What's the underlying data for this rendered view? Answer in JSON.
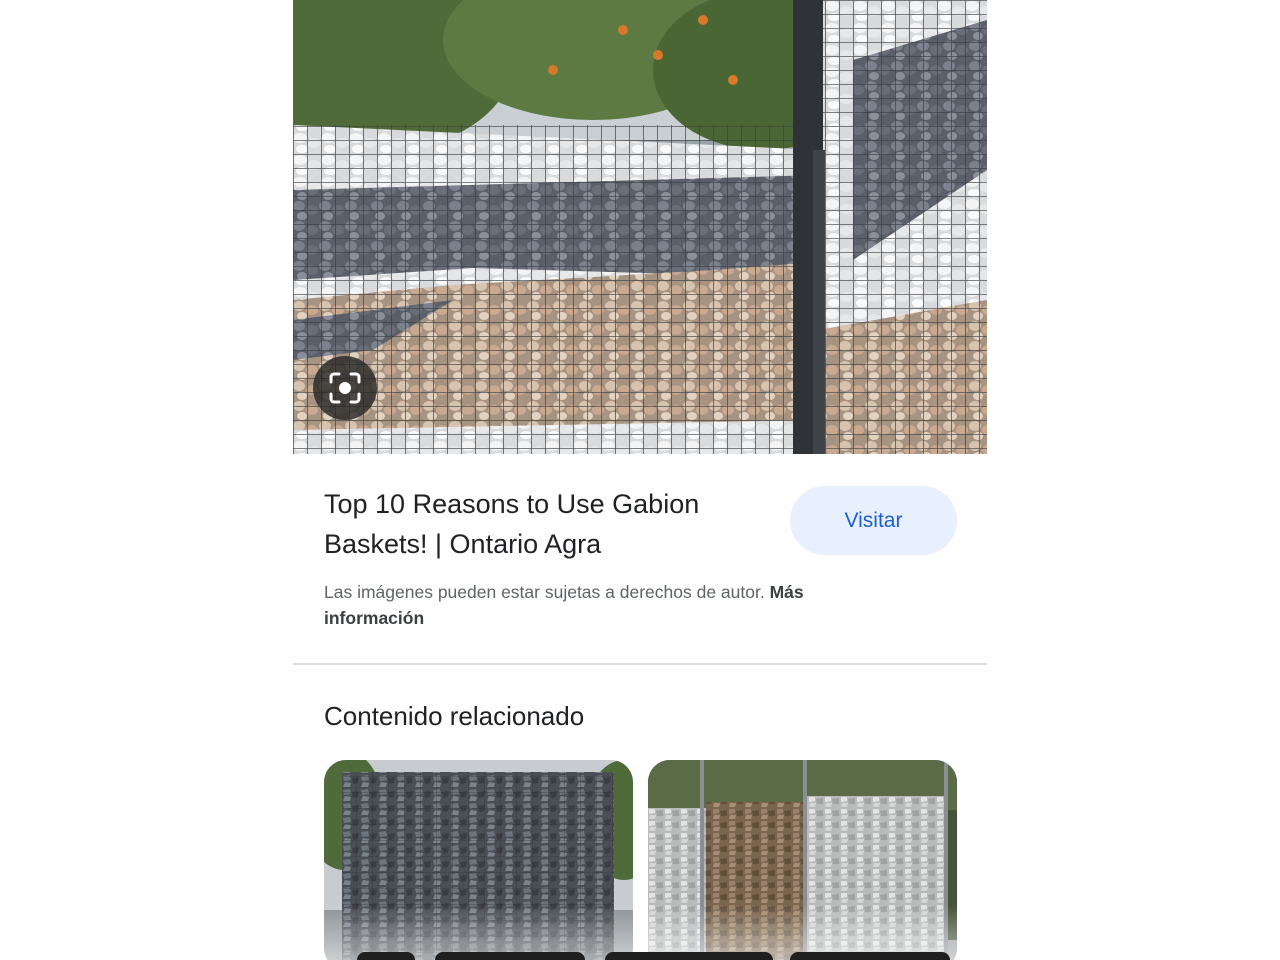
{
  "result": {
    "title": "Top 10 Reasons to Use Gabion Baskets! | Ontario Agra",
    "visit_label": "Visitar",
    "copyright_text": "Las imágenes pueden estar sujetas a derechos de autor.",
    "copyright_link": "Más información"
  },
  "image_actions": {
    "lens_icon": "lens-search-icon"
  },
  "related": {
    "heading": "Contenido relacionado",
    "items": [
      {
        "thumbnail": "gabion-wall-dark-stones"
      },
      {
        "thumbnail": "gabion-fence-mixed-stones"
      }
    ]
  },
  "colors": {
    "accent": "#1a5fd4",
    "visit_button_bg": "#e8f0fe",
    "text_primary": "#202124",
    "text_secondary": "#5f6368"
  }
}
